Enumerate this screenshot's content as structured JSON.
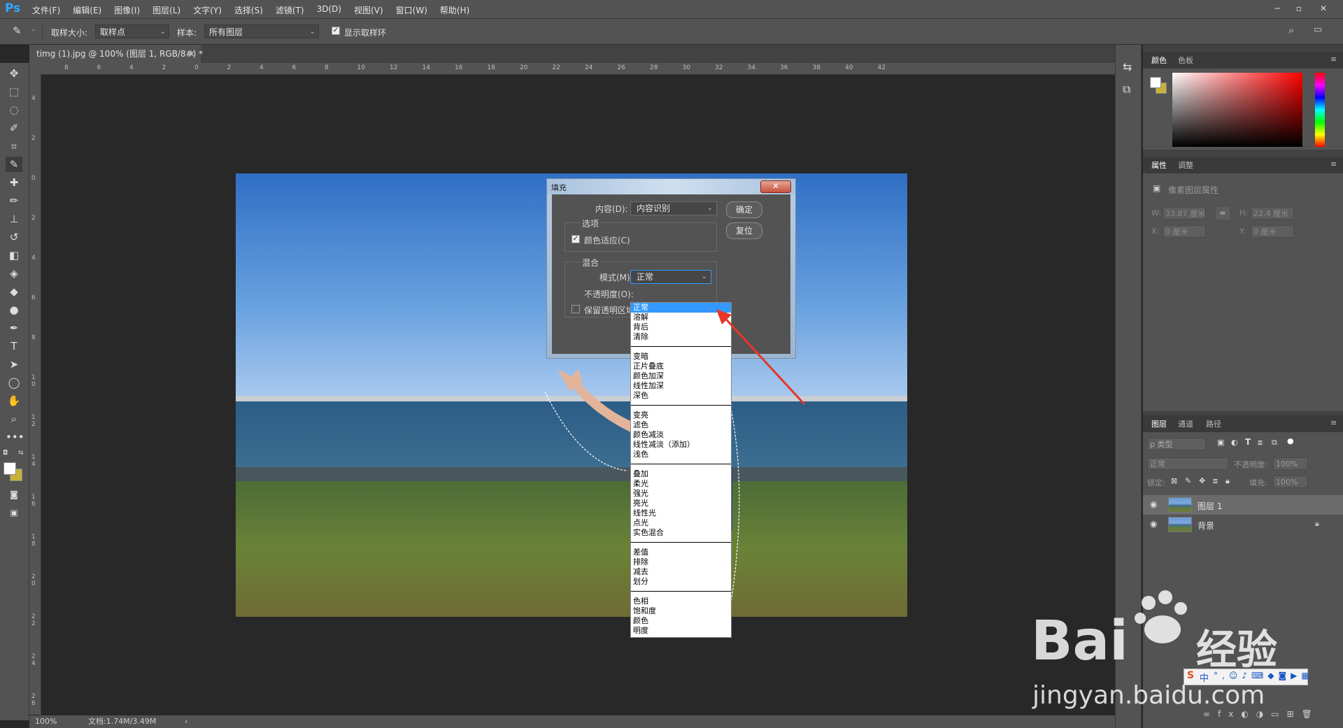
{
  "app": {
    "logo": "Ps",
    "menus": [
      "文件(F)",
      "编辑(E)",
      "图像(I)",
      "图层(L)",
      "文字(Y)",
      "选择(S)",
      "滤镜(T)",
      "3D(D)",
      "视图(V)",
      "窗口(W)",
      "帮助(H)"
    ],
    "window_buttons": [
      "─",
      "▫",
      "✕"
    ]
  },
  "options_bar": {
    "sample_size_label": "取样大小:",
    "sample_size_value": "取样点",
    "sample_label": "样本:",
    "sample_value": "所有图层",
    "show_ring_label": "显示取样环"
  },
  "document_tab": {
    "title": "timg (1).jpg @ 100% (图层 1, RGB/8#) *",
    "close": "×"
  },
  "ruler": {
    "h_ticks": [
      "8",
      "6",
      "4",
      "2",
      "0",
      "2",
      "4",
      "6",
      "8",
      "10",
      "12",
      "14",
      "16",
      "18",
      "20",
      "22",
      "24",
      "26",
      "28",
      "30",
      "32",
      "34",
      "36",
      "38",
      "40",
      "42"
    ],
    "v_ticks": [
      "4",
      "2",
      "0",
      "2",
      "4",
      "6",
      "8",
      "1 0",
      "1 2",
      "1 4",
      "1 6",
      "1 8",
      "2 0",
      "2 2",
      "2 4",
      "2 6"
    ]
  },
  "status": {
    "zoom": "100%",
    "doc_info": "文档:1.74M/3.49M",
    "arrow": "›"
  },
  "fill_dialog": {
    "title": "填充",
    "close": "✕",
    "content_label": "内容(D):",
    "content_value": "内容识别",
    "ok_label": "确定",
    "reset_label": "复位",
    "options_group": "选项",
    "color_adapt_label": "颜色适应(C)",
    "blend_group": "混合",
    "mode_label": "模式(M):",
    "mode_value": "正常",
    "opacity_label": "不透明度(O):",
    "preserve_label": "保留透明区域"
  },
  "blend_modes": [
    [
      "正常",
      "溶解",
      "背后",
      "清除"
    ],
    [
      "变暗",
      "正片叠底",
      "颜色加深",
      "线性加深",
      "深色"
    ],
    [
      "变亮",
      "滤色",
      "颜色减淡",
      "线性减淡（添加）",
      "浅色"
    ],
    [
      "叠加",
      "柔光",
      "强光",
      "亮光",
      "线性光",
      "点光",
      "实色混合"
    ],
    [
      "差值",
      "排除",
      "减去",
      "划分"
    ],
    [
      "色相",
      "饱和度",
      "颜色",
      "明度"
    ]
  ],
  "panels": {
    "color_tabs": [
      "颜色",
      "色板"
    ],
    "properties_tabs": [
      "属性",
      "调整"
    ],
    "properties_title": "像素图层属性",
    "props": {
      "w_label": "W:",
      "w_value": "33.87 厘米",
      "h_label": "H:",
      "h_value": "22.4 厘米",
      "x_label": "X:",
      "x_value": "0 厘米",
      "y_label": "Y:",
      "y_value": "0 厘米"
    },
    "layers_tabs": [
      "图层",
      "通道",
      "路径"
    ],
    "filter_value": "ρ 类型",
    "blend_value": "正常",
    "opacity_label": "不透明度:",
    "opacity_value": "100%",
    "lock_label": "锁定:",
    "fill_label": "填充:",
    "fill_value": "100%",
    "layers": [
      {
        "name": "图层 1",
        "selected": true
      },
      {
        "name": "背景",
        "selected": false
      }
    ]
  },
  "watermark": {
    "brand": "Bai",
    "brand2": "经验",
    "url": "jingyan.baidu.com",
    "ime": "中"
  },
  "colors": {
    "ui_dark": "#282828",
    "ui_panel": "#535353",
    "accent_blue": "#31a8ff",
    "highlight": "#3399ff",
    "arrow_red": "#e8362a",
    "bg_swatch": "#c9b23a"
  }
}
